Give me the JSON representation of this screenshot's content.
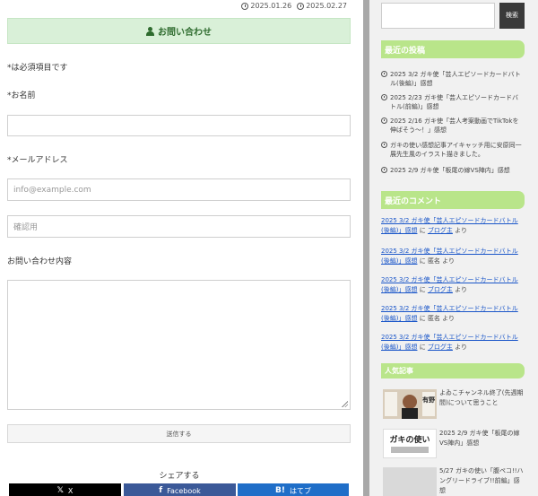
{
  "main": {
    "dates": {
      "published": "2025.01.26",
      "updated": "2025.02.27"
    },
    "contact_title": "お問い合わせ",
    "required_note": "*は必須項目です",
    "name_label": "*お名前",
    "email_label": "*メールアドレス",
    "email_placeholder": "info@example.com",
    "confirm_placeholder": "確認用",
    "message_label": "お問い合わせ内容",
    "submit_label": "送信する",
    "share_title": "シェアする",
    "share_buttons": [
      {
        "label": "X",
        "icon": "𝕏",
        "color": "#000000"
      },
      {
        "label": "Facebook",
        "icon": "f",
        "color": "#3b5998"
      },
      {
        "label": "はてブ",
        "icon": "B!",
        "color": "#1f6ec8"
      }
    ]
  },
  "sidebar": {
    "search_button": "検索",
    "recent_posts_title": "最近の投稿",
    "recent_posts": [
      "2025 3/2 ガキ使「芸人エピソードカードバトル(後編)」感想",
      "2025 2/23 ガキ使「芸人エピソードカードバトル(前編)」感想",
      "2025 2/16 ガキ使「芸人考案動画でTikTokを伸ばそう〜！」感想",
      "ガキの使い感想記事アイキャッチ用に安原同一展先生風のイラスト描きました。",
      "2025 2/9 ガキ使「板尾の嫁VS陣内」感想"
    ],
    "recent_comments_title": "最近のコメント",
    "recent_comments": [
      {
        "post": "2025 3/2 ガキ使「芸人エピソードカードバトル(後編)」感想",
        "sep": "に",
        "author": "ブログ主",
        "suffix": "より"
      },
      {
        "post": "2025 3/2 ガキ使「芸人エピソードカードバトル(後編)」感想",
        "sep": "に",
        "author": "匿名",
        "suffix": "より"
      },
      {
        "post": "2025 3/2 ガキ使「芸人エピソードカードバトル(後編)」感想",
        "sep": "に",
        "author": "ブログ主",
        "suffix": "より"
      },
      {
        "post": "2025 3/2 ガキ使「芸人エピソードカードバトル(後編)」感想",
        "sep": "に",
        "author": "匿名",
        "suffix": "より"
      },
      {
        "post": "2025 3/2 ガキ使「芸人エピソードカードバトル(後編)」感想",
        "sep": "に",
        "author": "ブログ主",
        "suffix": "より"
      }
    ],
    "popular_title": "人気記事",
    "popular": [
      {
        "title": "よゐこチャンネル終了(先週期間)について思うこと",
        "thumb_text": "有野"
      },
      {
        "title": "2025 2/9 ガキ使「板尾の嫁VS陣内」感想",
        "thumb_text": "ガキの使い"
      },
      {
        "title": "5/27 ガキの使い「腹ペコ!!ハングリードライブ!!前編」感想",
        "thumb_text": ""
      }
    ]
  }
}
